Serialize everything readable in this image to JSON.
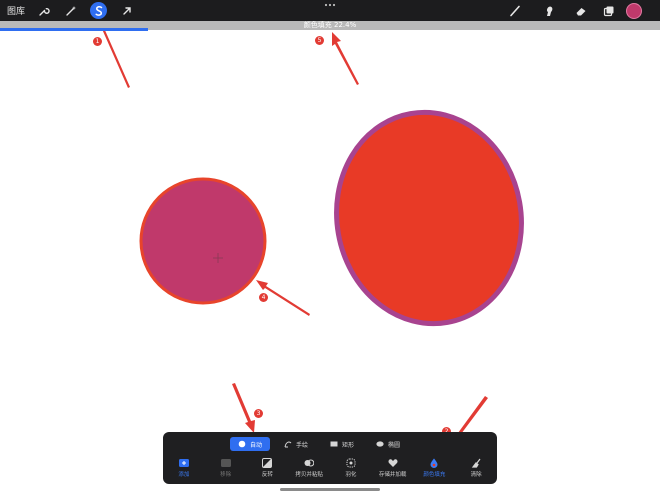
{
  "toolbar": {
    "gallery_label": "图库",
    "tools": [
      {
        "icon": "wrench-icon",
        "active": false
      },
      {
        "icon": "magic-wand-icon",
        "active": false
      },
      {
        "icon": "selection-s-icon",
        "active": true
      },
      {
        "icon": "arrow-cursor-icon",
        "active": false
      }
    ],
    "right_tools": [
      {
        "icon": "brush-icon"
      },
      {
        "icon": "smudge-icon"
      },
      {
        "icon": "eraser-icon"
      },
      {
        "icon": "layers-icon"
      }
    ],
    "current_color": "#c0396b"
  },
  "status": {
    "text": "颜色填充 22.4%",
    "progress": 22.4
  },
  "selection_panel": {
    "modes": [
      {
        "label": "自动",
        "icon": "auto-dot-icon",
        "active": true
      },
      {
        "label": "手绘",
        "icon": "freehand-icon",
        "active": false
      },
      {
        "label": "矩形",
        "icon": "rectangle-icon",
        "active": false
      },
      {
        "label": "椭圆",
        "icon": "ellipse-icon",
        "active": false
      }
    ],
    "tools": [
      {
        "label": "添加",
        "icon": "add-icon",
        "state": "active"
      },
      {
        "label": "移除",
        "icon": "remove-icon",
        "state": "dim"
      },
      {
        "label": "反转",
        "icon": "invert-icon",
        "state": "normal"
      },
      {
        "label": "拷贝并粘贴",
        "icon": "copy-paste-icon",
        "state": "normal"
      },
      {
        "label": "羽化",
        "icon": "feather-icon",
        "state": "normal"
      },
      {
        "label": "存储并加载",
        "icon": "heart-icon",
        "state": "normal"
      },
      {
        "label": "颜色填充",
        "icon": "color-fill-icon",
        "state": "active"
      },
      {
        "label": "清除",
        "icon": "clear-icon",
        "state": "normal"
      }
    ]
  },
  "annotations": [
    {
      "number": "1"
    },
    {
      "number": "2"
    },
    {
      "number": "3"
    },
    {
      "number": "4"
    },
    {
      "number": "5"
    }
  ],
  "colors": {
    "accent": "#2f6ef0",
    "circle_fill": "#c0396b",
    "circle_stroke": "#e8442b",
    "ellipse_fill": "#e83a26",
    "ellipse_stroke": "#a8438f",
    "annotation": "#e23b34"
  }
}
